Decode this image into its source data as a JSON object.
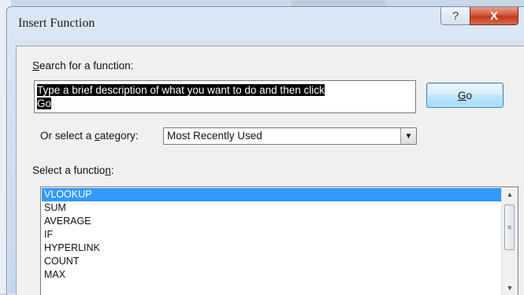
{
  "dialog": {
    "title": "Insert Function",
    "help_label": "?",
    "close_label": "X"
  },
  "search": {
    "label_prefix": "",
    "label_access": "S",
    "label_rest": "earch for a function:",
    "value_line1": "Type a brief description of what you want to do and then click",
    "value_line2": "Go",
    "go_access": "G",
    "go_rest": "o"
  },
  "category": {
    "label_prefix": "Or select a ",
    "label_access": "c",
    "label_rest": "ategory:",
    "selected": "Most Recently Used"
  },
  "functions": {
    "label_prefix": "Select a functio",
    "label_access": "n",
    "label_rest": ":",
    "items": [
      "VLOOKUP",
      "SUM",
      "AVERAGE",
      "IF",
      "HYPERLINK",
      "COUNT",
      "MAX"
    ],
    "selected_index": 0
  },
  "colors": {
    "selection": "#3399ff",
    "close_button": "#c13a1d"
  }
}
